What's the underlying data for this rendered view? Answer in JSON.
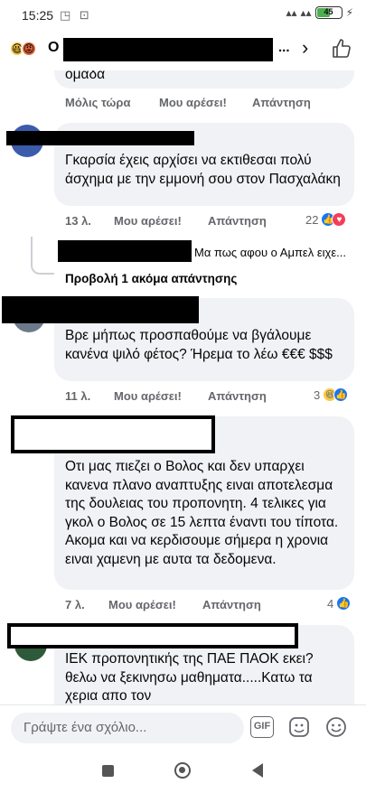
{
  "status_bar": {
    "time": "15:25",
    "icons": "◳ ⊡",
    "signal": "▴▴",
    "battery": "45",
    "charging": "⚡"
  },
  "header": {
    "initial": "Ο",
    "dots": "...",
    "chevron": "›"
  },
  "comments": [
    {
      "text": "ομαδα",
      "time": "Μόλις τώρα",
      "like_label": "Μου αρέσει!",
      "reply_label": "Απάντηση"
    },
    {
      "text": "Γκαρσία έχεις αρχίσει να εκτιθεσαι πολύ άσχημα με την εμμονή σου στον Πασχαλάκη",
      "time": "13 λ.",
      "like_label": "Μου αρέσει!",
      "reply_label": "Απάντηση",
      "reaction_count": "22",
      "reactions": [
        "like",
        "love"
      ],
      "reply_preview": "Μα πως αφου ο Αμπελ ειχε...",
      "more_replies": "Προβολή 1 ακόμα απάντησης"
    },
    {
      "text": "Βρε μήπως προσπαθούμε να βγάλουμε κανένα ψιλό φέτος? Ήρεμα το λέω €€€ $$$",
      "time": "11 λ.",
      "like_label": "Μου αρέσει!",
      "reply_label": "Απάντηση",
      "reaction_count": "3",
      "reactions": [
        "haha",
        "like"
      ]
    },
    {
      "text": "Οτι μας πιεζει ο Βολος και δεν υπαρχει κανενα πλανο αναπτυξης ειναι αποτελεσμα της δουλειας του προπονητη. 4 τελικες για γκολ ο Βολος σε 15 λεπτα έναντι του τίποτα. Ακομα και να κερδισουμε σήμερα η χρονια ειναι χαμενη με αυτα τα δεδομενα.",
      "time": "7 λ.",
      "like_label": "Μου αρέσει!",
      "reply_label": "Απάντηση",
      "reaction_count": "4",
      "reactions": [
        "like"
      ]
    },
    {
      "text": "ΙΕΚ προπονητικής της ΠΑΕ ΠΑΟΚ εκει? θελω να ξεκινησω μαθηματα.....Κατω τα χερια απο τον"
    }
  ],
  "composer": {
    "placeholder": "Γράψτε ένα σχόλιο...",
    "gif_label": "GIF"
  },
  "icons": {
    "header_reactions": [
      "laugh-emoji-icon",
      "angry-emoji-icon"
    ],
    "like_outline": "thumbs-up-outline-icon",
    "sticker": "sticker-icon",
    "emoji": "smiley-icon"
  },
  "colors": {
    "bubble": "#f0f2f5",
    "meta": "#65676b",
    "like_blue": "#1877f2",
    "love_red": "#f33e58",
    "haha_yellow": "#f7c948"
  }
}
